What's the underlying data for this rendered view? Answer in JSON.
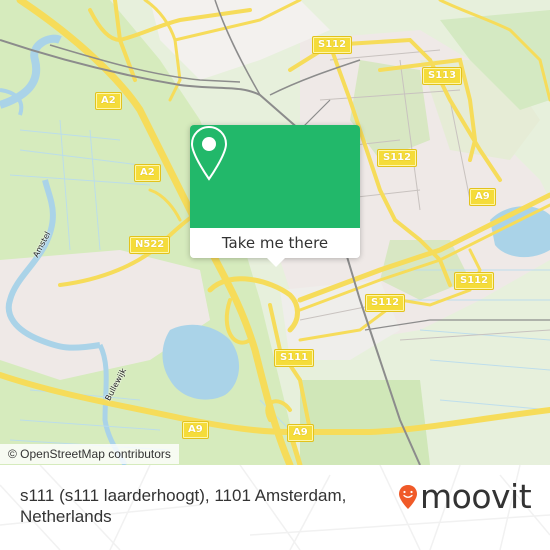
{
  "map": {
    "road_shields": [
      {
        "id": "a2-north",
        "text": "A2"
      },
      {
        "id": "a2-south",
        "text": "A2"
      },
      {
        "id": "n522",
        "text": "N522"
      },
      {
        "id": "s112-top",
        "text": "S112"
      },
      {
        "id": "s113",
        "text": "S113"
      },
      {
        "id": "s112-mid",
        "text": "S112"
      },
      {
        "id": "a9-east",
        "text": "A9"
      },
      {
        "id": "s112-east",
        "text": "S112"
      },
      {
        "id": "s112-center",
        "text": "S112"
      },
      {
        "id": "s111",
        "text": "S111"
      },
      {
        "id": "a9-west",
        "text": "A9"
      },
      {
        "id": "a9-south",
        "text": "A9"
      }
    ],
    "place_labels": [
      {
        "id": "amstel",
        "text": "Amstel"
      },
      {
        "id": "bullewijk",
        "text": "Bullewijk"
      }
    ],
    "attribution": "© OpenStreetMap contributors",
    "colors": {
      "land": "#e7f0dc",
      "grass": "#cfe8b4",
      "urban": "#efe9e7",
      "water": "#aad3e8",
      "motorway": "#f6dc5a",
      "rail": "#8c8c8c"
    }
  },
  "popup": {
    "icon": "map-pin-icon",
    "button_label": "Take me there",
    "accent_color": "#22b86a"
  },
  "footer": {
    "address_line1": "s111 (s111 laarderhoogt), 1101 Amsterdam,",
    "address_line2": "Netherlands",
    "logo_text": "moovit",
    "logo_icon": "moovit-pin-icon",
    "logo_color": "#f05a28"
  }
}
